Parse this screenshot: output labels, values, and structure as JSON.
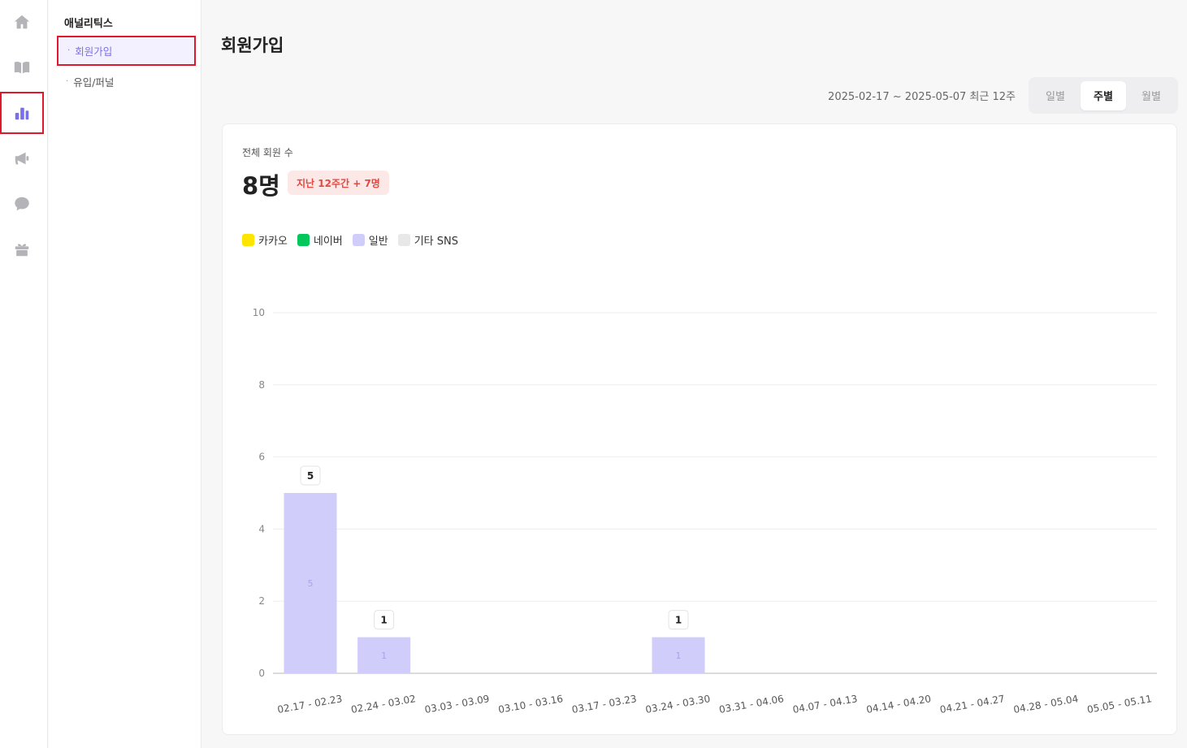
{
  "sidebar": {
    "icons": [
      {
        "name": "home-icon"
      },
      {
        "name": "book-icon"
      },
      {
        "name": "analytics-icon"
      },
      {
        "name": "megaphone-icon"
      },
      {
        "name": "chat-icon"
      },
      {
        "name": "gift-icon"
      }
    ],
    "active_index": 2
  },
  "subnav": {
    "title": "애널리틱스",
    "items": [
      {
        "label": "회원가입",
        "active": true
      },
      {
        "label": "유입/퍼널",
        "active": false
      }
    ]
  },
  "page": {
    "title": "회원가입",
    "range": "2025-02-17 ~ 2025-05-07 최근 12주",
    "period_options": [
      {
        "label": "일별",
        "active": false
      },
      {
        "label": "주별",
        "active": true
      },
      {
        "label": "월별",
        "active": false
      }
    ]
  },
  "metric": {
    "label": "전체 회원 수",
    "value": "8명",
    "badge": "지난 12주간 + 7명"
  },
  "colors": {
    "accent": "#7a6fe8",
    "kakao": "#fde500",
    "naver": "#03c75a",
    "general": "#d1cdfb",
    "other_sns": "#e8e8e8"
  },
  "chart_data": {
    "type": "bar",
    "stacked": true,
    "legend_position": "top-left",
    "grid": true,
    "ylim": [
      0,
      10
    ],
    "yticks": [
      0,
      2,
      4,
      6,
      8,
      10
    ],
    "categories": [
      "02.17 - 02.23",
      "02.24 - 03.02",
      "03.03 - 03.09",
      "03.10 - 03.16",
      "03.17 - 03.23",
      "03.24 - 03.30",
      "03.31 - 04.06",
      "04.07 - 04.13",
      "04.14 - 04.20",
      "04.21 - 04.27",
      "04.28 - 05.04",
      "05.05 - 05.11"
    ],
    "series": [
      {
        "name": "카카오",
        "color": "#fde500",
        "values": [
          0,
          0,
          0,
          0,
          0,
          0,
          0,
          0,
          0,
          0,
          0,
          0
        ]
      },
      {
        "name": "네이버",
        "color": "#03c75a",
        "values": [
          0,
          0,
          0,
          0,
          0,
          0,
          0,
          0,
          0,
          0,
          0,
          0
        ]
      },
      {
        "name": "일반",
        "color": "#d1cdfb",
        "values": [
          5,
          1,
          0,
          0,
          0,
          1,
          0,
          0,
          0,
          0,
          0,
          0
        ]
      },
      {
        "name": "기타 SNS",
        "color": "#e8e8e8",
        "values": [
          0,
          0,
          0,
          0,
          0,
          0,
          0,
          0,
          0,
          0,
          0,
          0
        ]
      }
    ]
  }
}
